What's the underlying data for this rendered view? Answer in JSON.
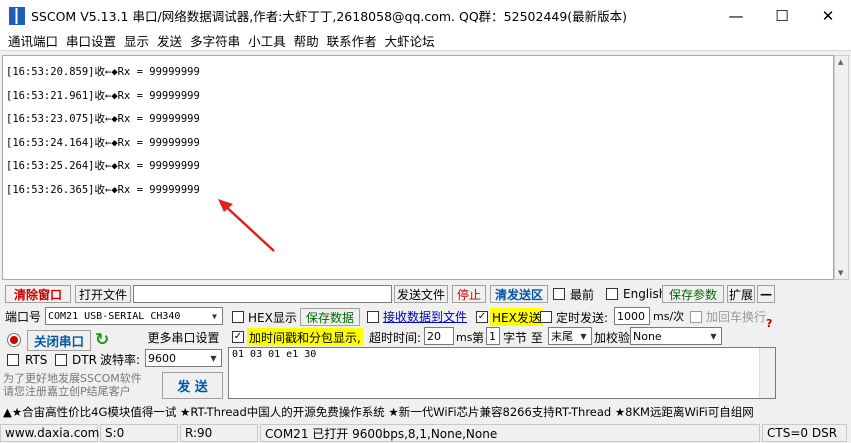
{
  "window": {
    "title": "SSCOM V5.13.1 串口/网络数据调试器,作者:大虾丁丁,2618058@qq.com. QQ群：52502449(最新版本)",
    "minimize": "—",
    "maximize": "☐",
    "close": "✕"
  },
  "menu": [
    "通讯端口",
    "串口设置",
    "显示",
    "发送",
    "多字符串",
    "小工具",
    "帮助",
    "联系作者",
    "大虾论坛"
  ],
  "log": [
    "[16:53:20.859]收←◆Rx = 99999999",
    "[16:53:21.961]收←◆Rx = 99999999",
    "[16:53:23.075]收←◆Rx = 99999999",
    "[16:53:24.164]收←◆Rx = 99999999",
    "[16:53:25.264]收←◆Rx = 99999999",
    "[16:53:26.365]收←◆Rx = 99999999"
  ],
  "toolbar": {
    "clear_window": "清除窗口",
    "open_file": "打开文件",
    "file_path": "",
    "send_file": "发送文件",
    "stop": "停止",
    "clear_send": "清发送区",
    "topmost": "最前",
    "english": "English",
    "save_params": "保存参数",
    "expand": "扩展",
    "collapse": "—"
  },
  "port": {
    "port_label": "端口号",
    "port_value": "COM21 USB-SERIAL CH340",
    "close_port": "关闭串口",
    "more_settings": "更多串口设置",
    "rts": "RTS",
    "dtr": "DTR",
    "baud_label": "波特率:",
    "baud_value": "9600",
    "promo": "为了更好地发展SSCOM软件\n请您注册嘉立创P结尾客户",
    "send": "发  送"
  },
  "options": {
    "hex_display": "HEX显示",
    "save_data": "保存数据",
    "recv_to_file": "接收数据到文件",
    "hex_send": "HEX发送",
    "timed_send": "定时发送:",
    "interval": "1000",
    "interval_unit": "ms/次",
    "add_crlf": "加回车换行",
    "timestamp_split": "加时间戳和分包显示,",
    "timeout_label": "超时时间:",
    "timeout_value": "20",
    "timeout_unit": "ms",
    "byte_prefix": "第",
    "byte_index": "1",
    "byte_mid": "字节 至",
    "byte_end": "末尾",
    "checksum_label": "加校验",
    "checksum_value": "None",
    "help": "?"
  },
  "send_text": "01 03 01 e1 30",
  "marquee": "▲★合宙高性价比4G模块值得一试 ★RT-Thread中国人的开源免费操作系统 ★新一代WiFi芯片兼容8266支持RT-Thread ★8KM远距离WiFi可自组网",
  "status": {
    "site": "www.daxia.com",
    "sent": "S:0",
    "received": "R:90",
    "port_state": "COM21 已打开  9600bps,8,1,None,None",
    "lines": "CTS=0 DSR"
  }
}
